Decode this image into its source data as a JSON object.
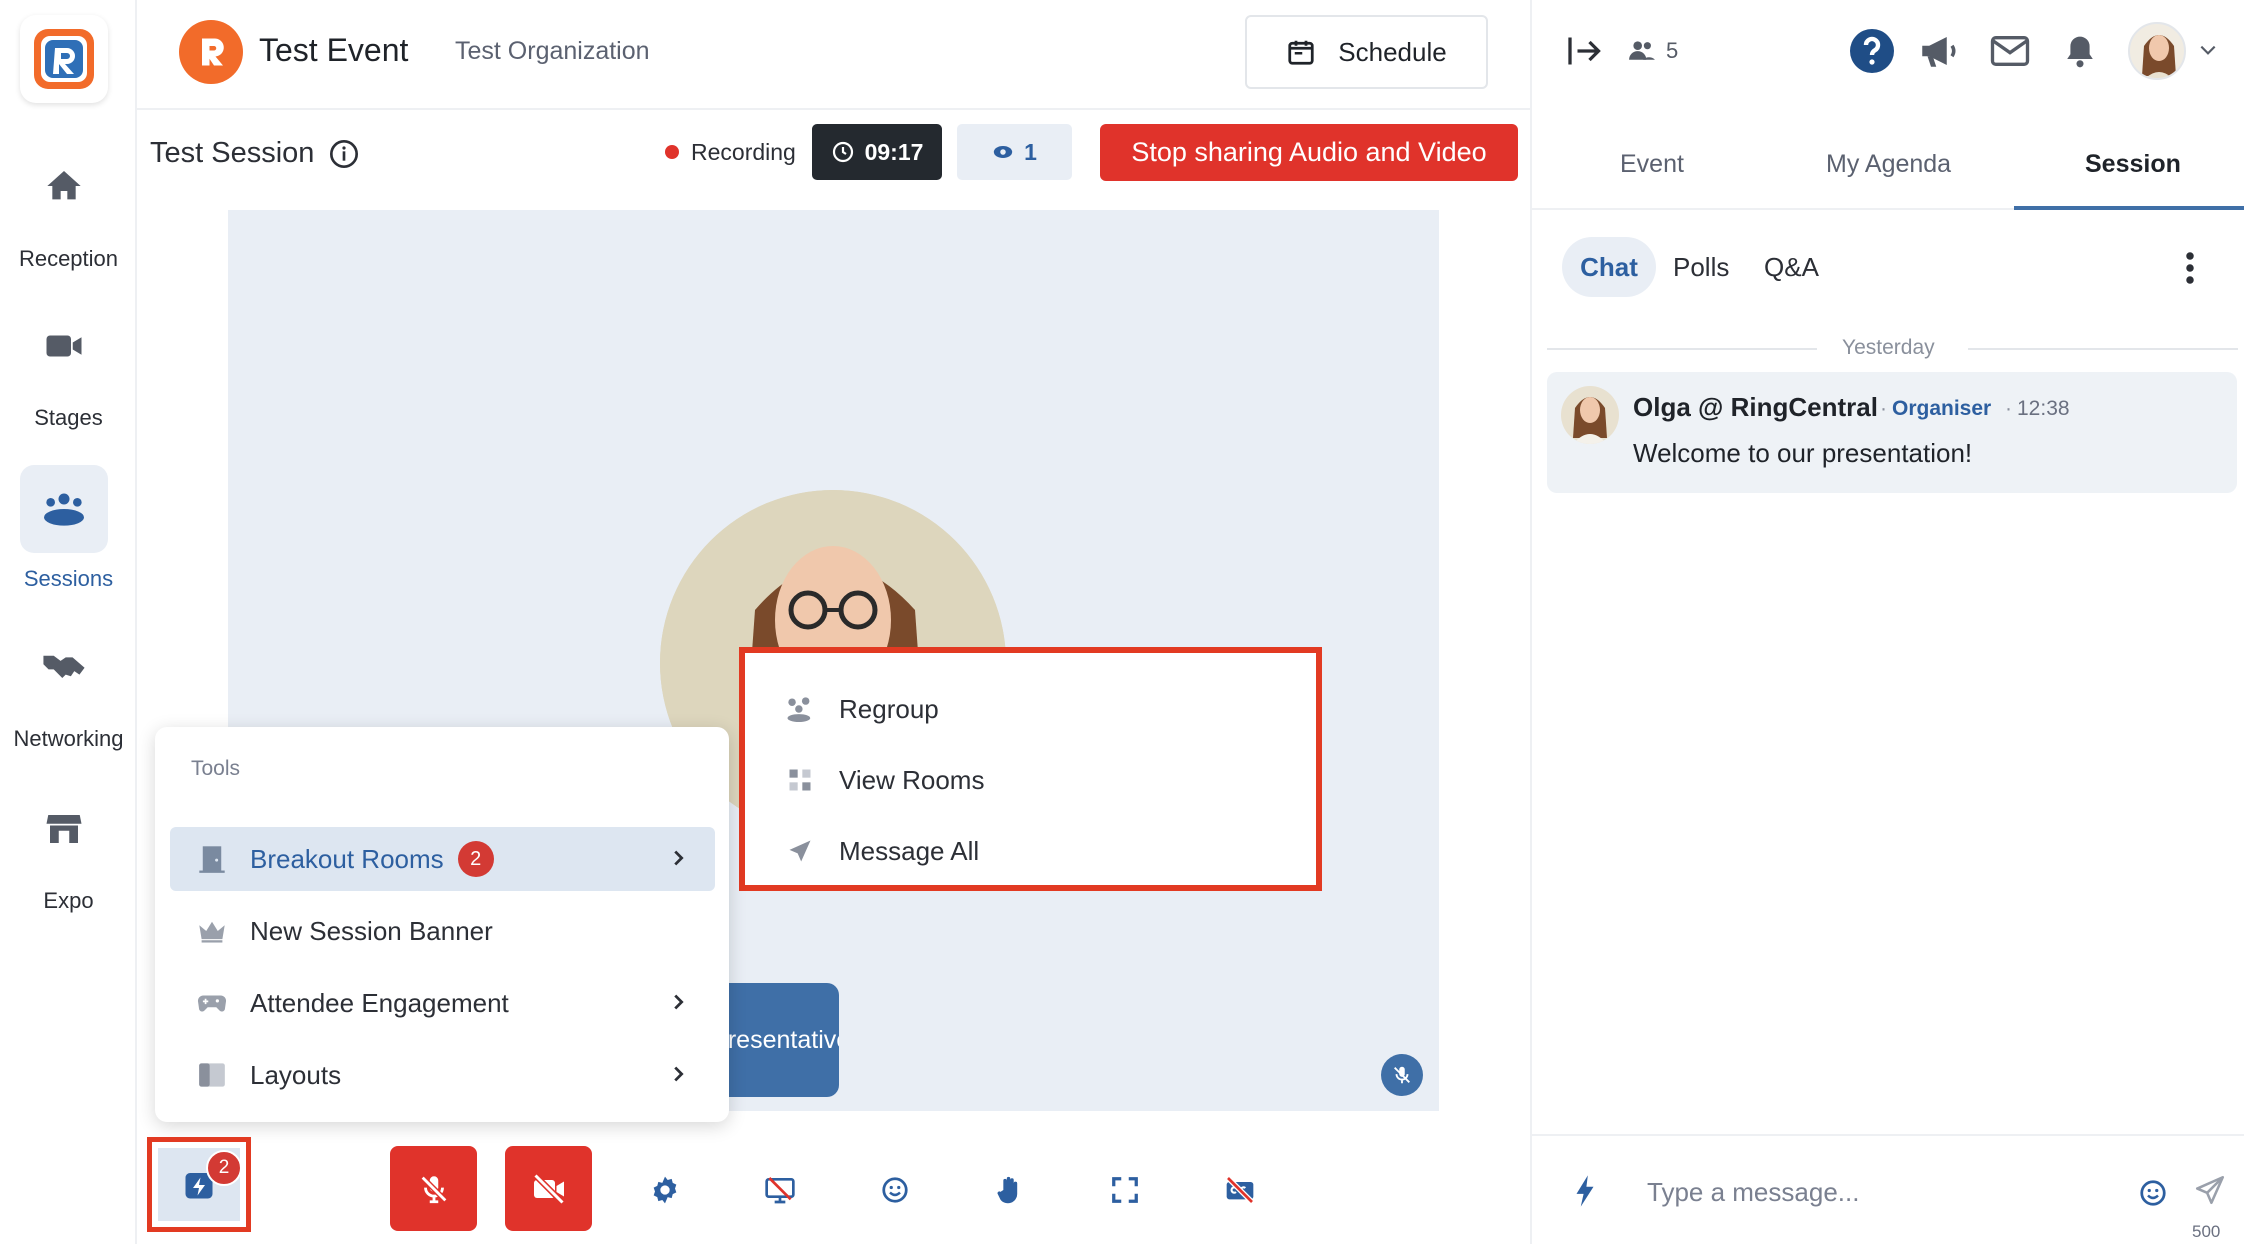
{
  "nav": {
    "items": [
      {
        "label": "Reception",
        "icon": "home-icon"
      },
      {
        "label": "Stages",
        "icon": "video-camera-icon"
      },
      {
        "label": "Sessions",
        "icon": "people-group-icon",
        "active": true
      },
      {
        "label": "Networking",
        "icon": "handshake-icon"
      },
      {
        "label": "Expo",
        "icon": "storefront-icon"
      }
    ]
  },
  "topbar": {
    "event_title": "Test Event",
    "organization": "Test Organization",
    "schedule_label": "Schedule"
  },
  "session": {
    "title": "Test Session",
    "recording_label": "Recording",
    "timer": "09:17",
    "viewer_count": "1",
    "stop_sharing_label": "Stop sharing Audio and Video"
  },
  "stage": {
    "presenter_label": "Representative"
  },
  "tools_menu": {
    "heading": "Tools",
    "items": [
      {
        "label": "Breakout Rooms",
        "badge": "2",
        "icon": "door-icon",
        "has_submenu": true
      },
      {
        "label": "New Session Banner",
        "icon": "crown-icon",
        "has_submenu": false
      },
      {
        "label": "Attendee Engagement",
        "icon": "gamepad-icon",
        "has_submenu": true
      },
      {
        "label": "Layouts",
        "icon": "layout-icon",
        "has_submenu": true
      }
    ]
  },
  "breakout_submenu": {
    "items": [
      {
        "label": "Regroup",
        "icon": "group-icon"
      },
      {
        "label": "View Rooms",
        "icon": "grid-icon"
      },
      {
        "label": "Message All",
        "icon": "send-icon"
      }
    ]
  },
  "toolbar": {
    "tools_badge": "2"
  },
  "right_panel": {
    "attendee_count": "5",
    "tabs": [
      "Event",
      "My Agenda",
      "Session"
    ],
    "active_tab": "Session",
    "subtabs": [
      "Chat",
      "Polls",
      "Q&A"
    ],
    "active_subtab": "Chat",
    "day_divider": "Yesterday",
    "messages": [
      {
        "author": "Olga @ RingCentral",
        "role": "Organiser",
        "time": "12:38",
        "text": "Welcome to our presentation!"
      }
    ],
    "composer": {
      "placeholder": "Type a message...",
      "char_limit": "500"
    }
  },
  "colors": {
    "accent": "#3f6fa7",
    "danger": "#e0332b",
    "highlight_border": "#e23a22",
    "brand_orange": "#f26b2a"
  }
}
